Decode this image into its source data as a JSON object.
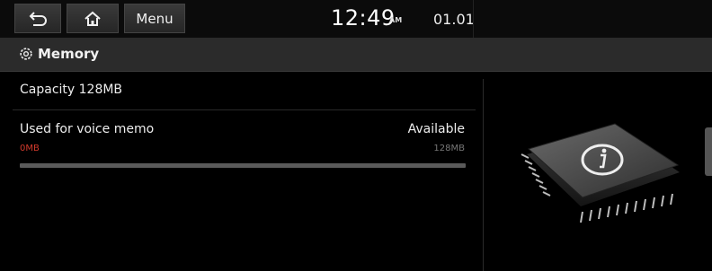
{
  "topbar": {
    "back_icon": "back-arrow-icon",
    "home_icon": "home-icon",
    "menu_label": "Menu",
    "time": "12:49",
    "ampm": "AM",
    "date": "01.01"
  },
  "header": {
    "icon": "gear-icon",
    "title": "Memory"
  },
  "memory": {
    "capacity": "Capacity 128MB",
    "used_label": "Used for voice memo",
    "used_value": "0MB",
    "available_label": "Available",
    "available_value": "128MB",
    "used_fraction": 0
  },
  "illustration": {
    "icon": "info-chip-icon"
  },
  "colors": {
    "accent_red": "#d23a2c",
    "header_bg": "#2b2b2b"
  }
}
